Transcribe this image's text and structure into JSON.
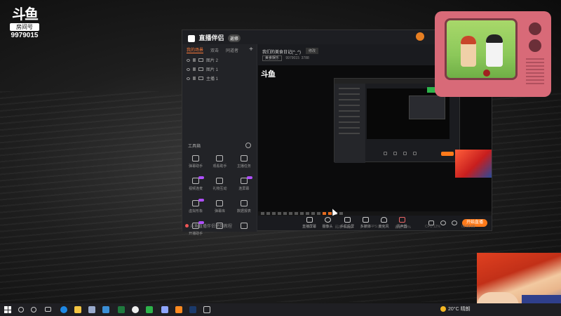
{
  "overlay_logo": {
    "name": "斗鱼",
    "sub": "房间号",
    "room_number": "9979015"
  },
  "app": {
    "title": "直播伴侣",
    "badge": "返修",
    "sidebar": {
      "tabs": [
        "我的场景",
        "双击",
        "同道者"
      ],
      "add_label": "+",
      "sources": [
        {
          "label": "图片 2"
        },
        {
          "label": "图片 1"
        },
        {
          "label": "主播 1"
        }
      ],
      "toolbox_title": "工具箱",
      "tools": [
        {
          "label": "弹幕助手",
          "hot": false
        },
        {
          "label": "观看助手",
          "hot": false
        },
        {
          "label": "主播任务",
          "hot": false
        },
        {
          "label": "视频连麦",
          "hot": true
        },
        {
          "label": "礼物互动",
          "hot": false
        },
        {
          "label": "连屏幕",
          "hot": true
        },
        {
          "label": "虚拟形象",
          "hot": true
        },
        {
          "label": "弹幕库",
          "hot": false
        },
        {
          "label": "数据报表",
          "hot": false
        },
        {
          "label": "开播助手",
          "hot": true
        },
        {
          "label": "",
          "hot": false
        },
        {
          "label": "",
          "hot": false
        }
      ],
      "help_text": "斗鱼直播伴侣使用教程"
    },
    "content": {
      "room_title": "我们的美食日记(^_^)",
      "edit_label": "修改",
      "category": "美食娱乐",
      "room_id": "9979015",
      "viewers": "3788",
      "preview_logo": "斗鱼"
    },
    "controls": [
      {
        "label": "直播屏幕"
      },
      {
        "label": "摄像头"
      },
      {
        "label": "手机投屏"
      },
      {
        "label": "多媒体"
      },
      {
        "label": "麦克风"
      },
      {
        "label": "扬声器"
      }
    ],
    "go_live_label": "开始直播",
    "status": {
      "bitrate": "码率:0kbps",
      "fps": "FPS:30",
      "drop": "丢帧:0.0%",
      "cpu": "CPU:12%",
      "timer": "00:00:00"
    }
  },
  "taskbar": {
    "weather": "20°C 晴朗",
    "apps": [
      "search-icon",
      "task-view-icon",
      "edge-icon",
      "folder-icon",
      "store-icon",
      "excel-icon",
      "obs-icon",
      "chrome-icon",
      "photos-icon",
      "app-icon",
      "steam-icon",
      "network-icon"
    ],
    "colors": {
      "edge": "#1e88e5",
      "folder": "#f4c542",
      "excel": "#1f7a3e",
      "chrome": "#e04b3a",
      "steam": "#1b3a6b",
      "app": "#ff8a1f"
    }
  }
}
